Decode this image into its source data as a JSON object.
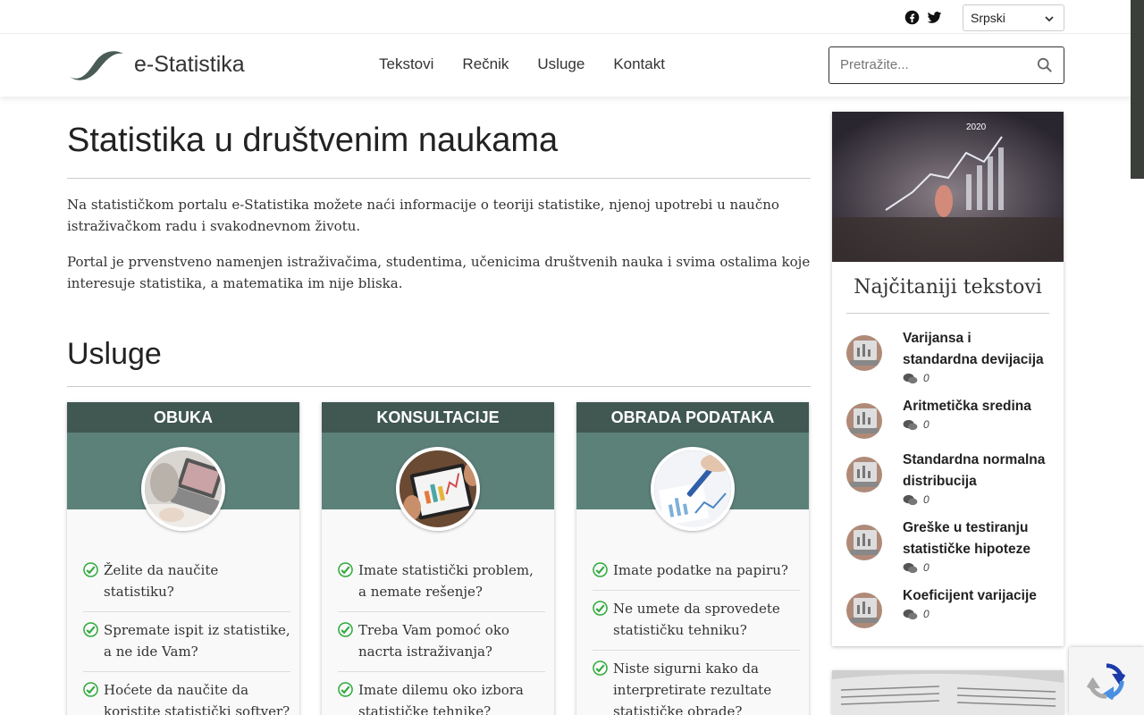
{
  "topbar": {
    "social": [
      {
        "icon": "facebook-icon"
      },
      {
        "icon": "twitter-icon"
      }
    ],
    "language": {
      "selected": "Srpski"
    }
  },
  "header": {
    "logo_text": "e-Statistika",
    "nav": [
      "Tekstovi",
      "Rečnik",
      "Usluge",
      "Kontakt"
    ],
    "search_placeholder": "Pretražite..."
  },
  "main": {
    "title": "Statistika u društvenim naukama",
    "paragraphs": [
      "Na statističkom portalu e-Statistika možete naći informacije o teoriji statistike, njenoj upotrebi u naučno istraživačkom radu i svakodnevnom životu.",
      "Portal je prvenstveno namenjen istraživačima, studentima, učenicima društvenih nauka i svima ostalima koje interesuje statistika, a matematika im nije bliska."
    ],
    "services_title": "Usluge",
    "cards": [
      {
        "title": "OBUKA",
        "items": [
          "Želite da naučite statistiku?",
          "Spremate ispit iz statistike, a ne ide Vam?",
          "Hoćete da naučite da koristite statistički softver?"
        ]
      },
      {
        "title": "KONSULTACIJE",
        "items": [
          "Imate statistički problem, a nemate rešenje?",
          "Treba Vam pomoć oko nacrta istraživanja?",
          "Imate dilemu oko izbora statističke tehnike?"
        ]
      },
      {
        "title": "OBRADA PODATAKA",
        "items": [
          "Imate podatke na papiru?",
          "Ne umete da sprovedete statističku tehniku?",
          "Niste sigurni kako da interpretirate rezultate statističke obrade?"
        ]
      }
    ]
  },
  "sidebar": {
    "image_label": "2020",
    "title": "Najčitaniji tekstovi",
    "posts": [
      {
        "title": "Varijansa i standardna devijacija",
        "comments": "0"
      },
      {
        "title": "Aritmetička sredina",
        "comments": "0"
      },
      {
        "title": "Standardna normalna distribucija",
        "comments": "0"
      },
      {
        "title": "Greške u testiranju statističke hipoteze",
        "comments": "0"
      },
      {
        "title": "Koeficijent varijacije",
        "comments": "0"
      }
    ]
  },
  "colors": {
    "card_head": "#405752",
    "card_band": "#5c8179",
    "check_green": "#2eaa3b"
  }
}
